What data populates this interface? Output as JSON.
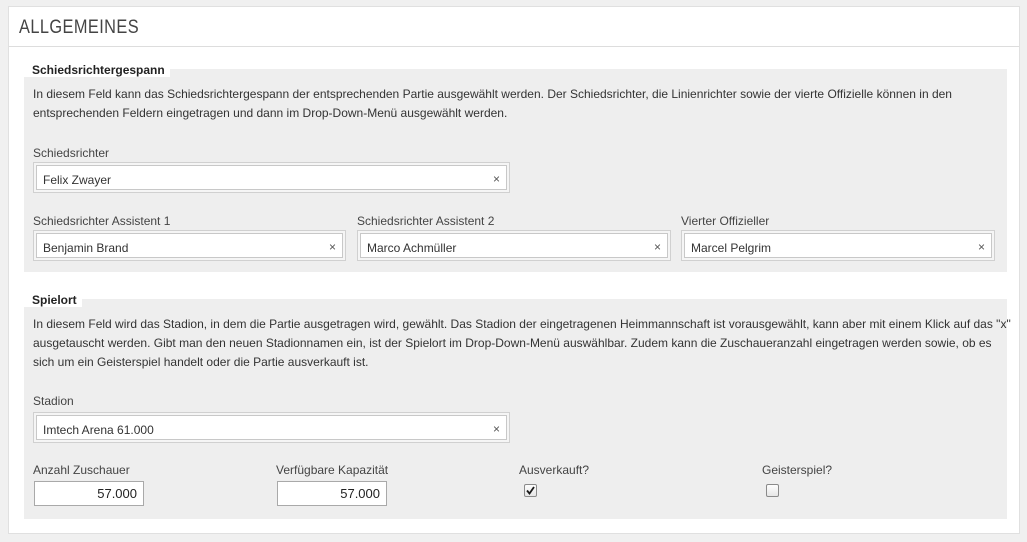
{
  "panel": {
    "title": "ALLGEMEINES"
  },
  "referees": {
    "legend": "Schiedsrichtergespann",
    "description": "In diesem Feld kann das Schiedsrichtergespann der entsprechenden Partie ausgewählt werden. Der Schiedsrichter, die Linienrichter sowie der vierte Offizielle können in den entsprechenden Feldern eingetragen und dann im Drop-Down-Menü ausgewählt werden.",
    "referee": {
      "label": "Schiedsrichter",
      "value": "Felix Zwayer"
    },
    "assistant1": {
      "label": "Schiedsrichter Assistent 1",
      "value": "Benjamin Brand"
    },
    "assistant2": {
      "label": "Schiedsrichter Assistent 2",
      "value": "Marco Achmüller"
    },
    "fourth": {
      "label": "Vierter Offizieller",
      "value": "Marcel Pelgrim"
    },
    "clear_glyph": "×"
  },
  "venue": {
    "legend": "Spielort",
    "description": "In diesem Feld wird das Stadion, in dem die Partie ausgetragen wird, gewählt. Das Stadion der eingetragenen Heimmannschaft ist vorausgewählt, kann aber mit einem Klick auf das \"x\" ausgetauscht werden. Gibt man den neuen Stadionnamen ein, ist der Spielort im Drop-Down-Menü auswählbar. Zudem kann die Zuschaueranzahl eingetragen werden sowie, ob es sich um ein Geisterspiel handelt oder die Partie ausverkauft ist.",
    "stadium": {
      "label": "Stadion",
      "value": "Imtech Arena 61.000"
    },
    "spectators": {
      "label": "Anzahl Zuschauer",
      "value": "57.000"
    },
    "capacity": {
      "label": "Verfügbare Kapazität",
      "value": "57.000"
    },
    "sold_out": {
      "label": "Ausverkauft?",
      "checked": true
    },
    "ghost_game": {
      "label": "Geisterspiel?",
      "checked": false
    }
  },
  "colors": {
    "fieldset_bg": "#eeeeee",
    "panel_bg": "#ffffff",
    "page_bg": "#f0f0f0"
  },
  "icons": {
    "clear": "close-icon",
    "check": "checkmark-icon"
  }
}
